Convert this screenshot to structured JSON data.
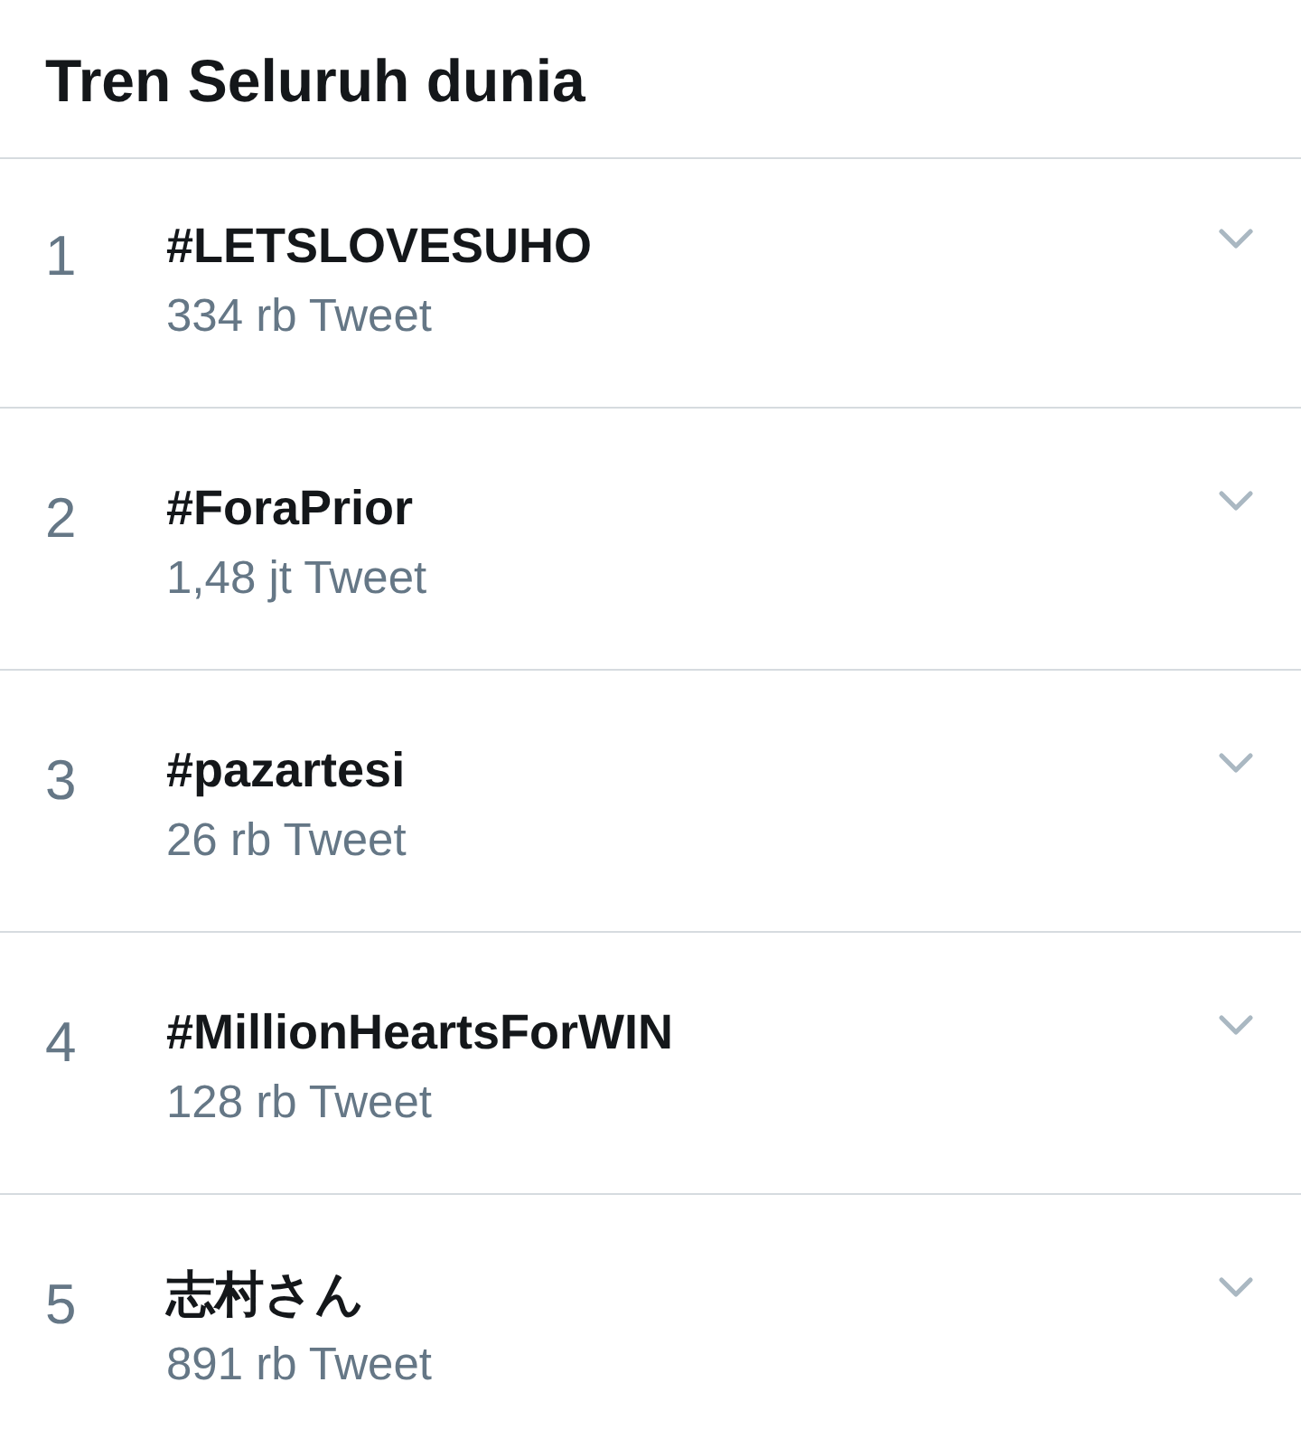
{
  "header": {
    "title": "Tren Seluruh dunia"
  },
  "trends": [
    {
      "rank": "1",
      "name": "#LETSLOVESUHO",
      "count": "334 rb Tweet"
    },
    {
      "rank": "2",
      "name": "#ForaPrior",
      "count": "1,48 jt Tweet"
    },
    {
      "rank": "3",
      "name": "#pazartesi",
      "count": "26 rb Tweet"
    },
    {
      "rank": "4",
      "name": "#MillionHeartsForWIN",
      "count": "128 rb Tweet"
    },
    {
      "rank": "5",
      "name": "志村さん",
      "count": "891 rb Tweet"
    }
  ]
}
